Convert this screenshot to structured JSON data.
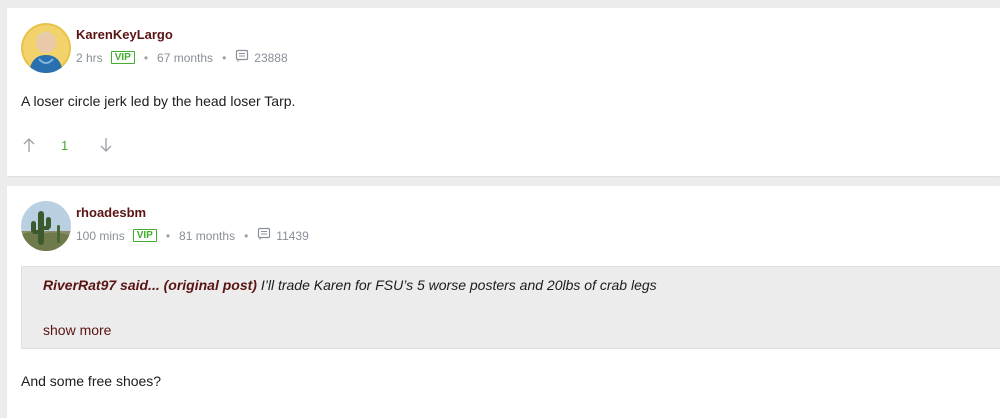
{
  "posts": [
    {
      "username": "KarenKeyLargo",
      "time": "2 hrs",
      "badge": "VIP",
      "tenure": "67 months",
      "message_count": "23888",
      "body": "A loser circle jerk led by the head loser Tarp.",
      "votes": "1"
    },
    {
      "username": "rhoadesbm",
      "time": "100 mins",
      "badge": "VIP",
      "tenure": "81 months",
      "message_count": "11439",
      "quote": {
        "author": "RiverRat97 said...",
        "link": "(original post)",
        "text": "I’ll trade Karen for FSU’s 5 worse posters and 20lbs of crab legs",
        "show_more": "show more"
      },
      "body": "And some free shoes?"
    }
  ],
  "colors": {
    "username": "#5a1414",
    "vip": "#3fae2a",
    "meta": "#8a8f98",
    "background": "#ececec"
  }
}
